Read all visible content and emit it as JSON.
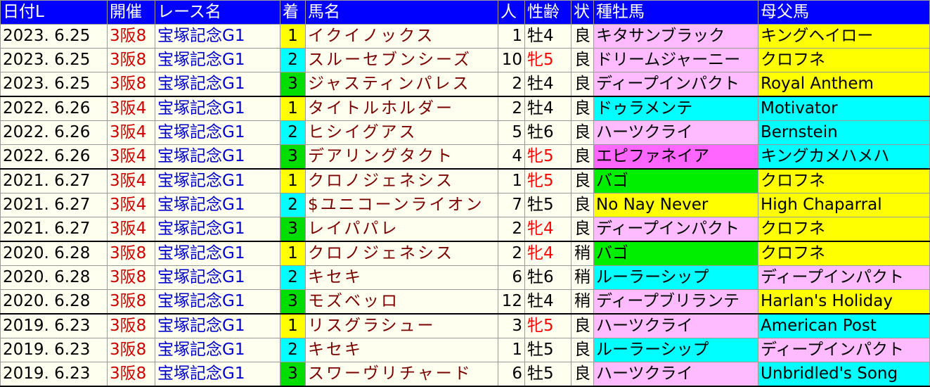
{
  "colors": {
    "header_bg": "#0000ff",
    "cell_bg": "#fffff0",
    "rank1": "#ffff00",
    "rank2": "#00ffff",
    "rank3": "#00dd00",
    "venue_text": "#cc0000",
    "race_text": "#0000cc",
    "horse_text": "#7a0000",
    "female_text": "#ff0000",
    "sire_yellow": "#ffff00",
    "sire_pink": "#ffbbff",
    "sire_cyan": "#00ffff",
    "sire_green": "#00ee00",
    "sire_magenta": "#ff66ff"
  },
  "headers": [
    "日付L",
    "開催",
    "レース名",
    "着",
    "馬名",
    "人",
    "性齢",
    "状",
    "種牡馬",
    "母父馬"
  ],
  "rows": [
    {
      "date": "2023. 6.25",
      "venue": "3阪8",
      "race": "宝塚記念G1",
      "rank": "1",
      "rank_color": "#ffff00",
      "horse": "イクイノックス",
      "pop": "1",
      "sexage": "牡4",
      "sexage_color": "#000000",
      "cond": "良",
      "sire": "キタサンブラック",
      "sire_color": "#ffbbff",
      "damsire": "キングヘイロー",
      "damsire_color": "#ffff00"
    },
    {
      "date": "2023. 6.25",
      "venue": "3阪8",
      "race": "宝塚記念G1",
      "rank": "2",
      "rank_color": "#00ffff",
      "horse": "スルーセブンシーズ",
      "pop": "10",
      "sexage": "牝5",
      "sexage_color": "#ff0000",
      "cond": "良",
      "sire": "ドリームジャーニー",
      "sire_color": "#ffbbff",
      "damsire": "クロフネ",
      "damsire_color": "#ffff00"
    },
    {
      "date": "2023. 6.25",
      "venue": "3阪8",
      "race": "宝塚記念G1",
      "rank": "3",
      "rank_color": "#00dd00",
      "horse": "ジャスティンパレス",
      "pop": "2",
      "sexage": "牡4",
      "sexage_color": "#000000",
      "cond": "良",
      "sire": "ディープインパクト",
      "sire_color": "#ffbbff",
      "damsire": "Royal Anthem",
      "damsire_color": "#ffff00"
    },
    {
      "date": "2022. 6.26",
      "venue": "3阪4",
      "race": "宝塚記念G1",
      "rank": "1",
      "rank_color": "#ffff00",
      "horse": "タイトルホルダー",
      "pop": "2",
      "sexage": "牡4",
      "sexage_color": "#000000",
      "cond": "良",
      "sire": "ドゥラメンテ",
      "sire_color": "#00ffff",
      "damsire": "Motivator",
      "damsire_color": "#00ffff"
    },
    {
      "date": "2022. 6.26",
      "venue": "3阪4",
      "race": "宝塚記念G1",
      "rank": "2",
      "rank_color": "#00ffff",
      "horse": "ヒシイグアス",
      "pop": "5",
      "sexage": "牡6",
      "sexage_color": "#000000",
      "cond": "良",
      "sire": "ハーツクライ",
      "sire_color": "#ffbbff",
      "damsire": "Bernstein",
      "damsire_color": "#00ffff"
    },
    {
      "date": "2022. 6.26",
      "venue": "3阪4",
      "race": "宝塚記念G1",
      "rank": "3",
      "rank_color": "#00dd00",
      "horse": "デアリングタクト",
      "pop": "4",
      "sexage": "牝5",
      "sexage_color": "#ff0000",
      "cond": "良",
      "sire": "エピファネイア",
      "sire_color": "#ff66ff",
      "damsire": "キングカメハメハ",
      "damsire_color": "#00ffff"
    },
    {
      "date": "2021. 6.27",
      "venue": "3阪4",
      "race": "宝塚記念G1",
      "rank": "1",
      "rank_color": "#ffff00",
      "horse": "クロノジェネシス",
      "pop": "1",
      "sexage": "牝5",
      "sexage_color": "#ff0000",
      "cond": "良",
      "sire": "バゴ",
      "sire_color": "#00ee00",
      "damsire": "クロフネ",
      "damsire_color": "#ffff00"
    },
    {
      "date": "2021. 6.27",
      "venue": "3阪4",
      "race": "宝塚記念G1",
      "rank": "2",
      "rank_color": "#00ffff",
      "horse": "$ユニコーンライオン",
      "pop": "7",
      "sexage": "牡5",
      "sexage_color": "#000000",
      "cond": "良",
      "sire": "No Nay Never",
      "sire_color": "#ffff00",
      "damsire": "High Chaparral",
      "damsire_color": "#ffff00"
    },
    {
      "date": "2021. 6.27",
      "venue": "3阪4",
      "race": "宝塚記念G1",
      "rank": "3",
      "rank_color": "#00dd00",
      "horse": "レイパパレ",
      "pop": "2",
      "sexage": "牝4",
      "sexage_color": "#ff0000",
      "cond": "良",
      "sire": "ディープインパクト",
      "sire_color": "#ffbbff",
      "damsire": "クロフネ",
      "damsire_color": "#ffff00"
    },
    {
      "date": "2020. 6.28",
      "venue": "3阪8",
      "race": "宝塚記念G1",
      "rank": "1",
      "rank_color": "#ffff00",
      "horse": "クロノジェネシス",
      "pop": "2",
      "sexage": "牝4",
      "sexage_color": "#ff0000",
      "cond": "稍",
      "sire": "バゴ",
      "sire_color": "#00ee00",
      "damsire": "クロフネ",
      "damsire_color": "#ffff00"
    },
    {
      "date": "2020. 6.28",
      "venue": "3阪8",
      "race": "宝塚記念G1",
      "rank": "2",
      "rank_color": "#00ffff",
      "horse": "キセキ",
      "pop": "6",
      "sexage": "牡6",
      "sexage_color": "#000000",
      "cond": "稍",
      "sire": "ルーラーシップ",
      "sire_color": "#00ffff",
      "damsire": "ディープインパクト",
      "damsire_color": "#ffbbff"
    },
    {
      "date": "2020. 6.28",
      "venue": "3阪8",
      "race": "宝塚記念G1",
      "rank": "3",
      "rank_color": "#00dd00",
      "horse": "モズベッロ",
      "pop": "12",
      "sexage": "牡4",
      "sexage_color": "#000000",
      "cond": "稍",
      "sire": "ディープブリランテ",
      "sire_color": "#ffbbff",
      "damsire": "Harlan's Holiday",
      "damsire_color": "#ffff00"
    },
    {
      "date": "2019. 6.23",
      "venue": "3阪8",
      "race": "宝塚記念G1",
      "rank": "1",
      "rank_color": "#ffff00",
      "horse": "リスグラシュー",
      "pop": "3",
      "sexage": "牝5",
      "sexage_color": "#ff0000",
      "cond": "良",
      "sire": "ハーツクライ",
      "sire_color": "#ffbbff",
      "damsire": "American Post",
      "damsire_color": "#00ffff"
    },
    {
      "date": "2019. 6.23",
      "venue": "3阪8",
      "race": "宝塚記念G1",
      "rank": "2",
      "rank_color": "#00ffff",
      "horse": "キセキ",
      "pop": "1",
      "sexage": "牡5",
      "sexage_color": "#000000",
      "cond": "良",
      "sire": "ルーラーシップ",
      "sire_color": "#00ffff",
      "damsire": "ディープインパクト",
      "damsire_color": "#ffbbff"
    },
    {
      "date": "2019. 6.23",
      "venue": "3阪8",
      "race": "宝塚記念G1",
      "rank": "3",
      "rank_color": "#00dd00",
      "horse": "スワーヴリチャード",
      "pop": "6",
      "sexage": "牡5",
      "sexage_color": "#000000",
      "cond": "良",
      "sire": "ハーツクライ",
      "sire_color": "#ffbbff",
      "damsire": "Unbridled's Song",
      "damsire_color": "#00ffff"
    }
  ]
}
